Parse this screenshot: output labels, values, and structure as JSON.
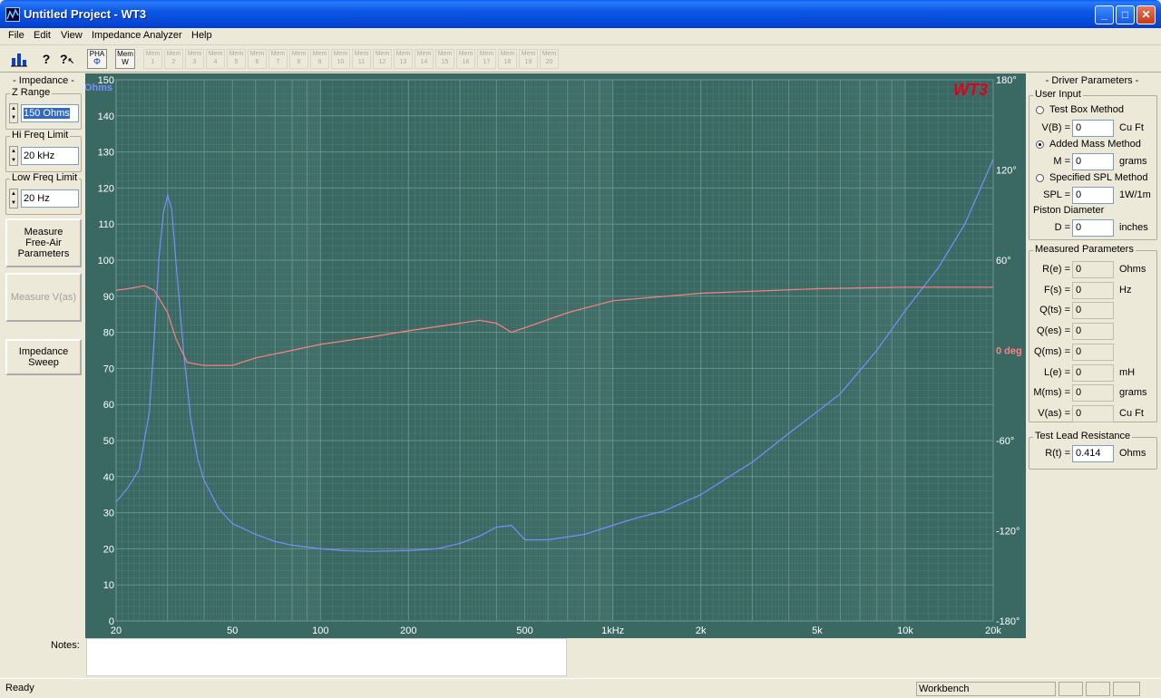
{
  "window": {
    "title": "Untitled Project - WT3",
    "minimize": "_",
    "maximize": "□",
    "close": "✕"
  },
  "menu": [
    "File",
    "Edit",
    "View",
    "Impedance Analyzer",
    "Help"
  ],
  "toolbar": {
    "pha_top": "PHA",
    "pha_bottom": "Φ",
    "mem_top": "Mem",
    "mem_bottom": "W",
    "mem_labels": [
      "1",
      "2",
      "3",
      "4",
      "5",
      "6",
      "7",
      "8",
      "9",
      "10",
      "11",
      "12",
      "13",
      "14",
      "15",
      "16",
      "17",
      "18",
      "19",
      "20"
    ]
  },
  "left": {
    "header": "- Impedance -",
    "z_range": {
      "label": "Z Range",
      "value": "150 Ohms"
    },
    "hi_freq": {
      "label": "Hi Freq Limit",
      "value": "20 kHz"
    },
    "low_freq": {
      "label": "Low Freq Limit",
      "value": "20 Hz"
    },
    "measure_free_air": "Measure Free-Air Parameters",
    "measure_vas": "Measure V(as)",
    "impedance_sweep": "Impedance Sweep"
  },
  "graph": {
    "logo": "WT3",
    "y_unit": "Ohms",
    "y_ticks": [
      "150",
      "140",
      "130",
      "120",
      "110",
      "100",
      "90",
      "80",
      "70",
      "60",
      "50",
      "40",
      "30",
      "20",
      "10",
      "0"
    ],
    "phase_ticks": [
      "180°",
      "120°",
      "60°",
      "0 deg",
      "-60°",
      "-120°",
      "-180°"
    ],
    "x_ticks": [
      {
        "f": 20,
        "label": "20"
      },
      {
        "f": 50,
        "label": "50"
      },
      {
        "f": 100,
        "label": "100"
      },
      {
        "f": 200,
        "label": "200"
      },
      {
        "f": 500,
        "label": "500"
      },
      {
        "f": 1000,
        "label": "1kHz"
      },
      {
        "f": 2000,
        "label": "2k"
      },
      {
        "f": 5000,
        "label": "5k"
      },
      {
        "f": 10000,
        "label": "10k"
      },
      {
        "f": 20000,
        "label": "20k"
      }
    ],
    "colors": {
      "background": "#3a6963",
      "impedance": "#7c8cff",
      "phase": "#ff8080",
      "grid": "#6f9590",
      "axis_text": "#ffffff",
      "logo": "#e0001c"
    }
  },
  "chart_data": {
    "type": "line",
    "xlabel": "",
    "ylabel": "Ohms",
    "xscale": "log",
    "xlim": [
      20,
      20000
    ],
    "ylim": [
      0,
      150
    ],
    "y2lim": [
      -180,
      180
    ],
    "grid": true,
    "series": [
      {
        "axis": "left",
        "values": [
          [
            20,
            33
          ],
          [
            22,
            37
          ],
          [
            24,
            42
          ],
          [
            26,
            58
          ],
          [
            27,
            78
          ],
          [
            28,
            100
          ],
          [
            29,
            113
          ],
          [
            30,
            118
          ],
          [
            31,
            114
          ],
          [
            32,
            100
          ],
          [
            34,
            75
          ],
          [
            36,
            56
          ],
          [
            38,
            45
          ],
          [
            40,
            39
          ],
          [
            45,
            31
          ],
          [
            50,
            27
          ],
          [
            60,
            24
          ],
          [
            70,
            22
          ],
          [
            80,
            21
          ],
          [
            100,
            20
          ],
          [
            120,
            19.5
          ],
          [
            150,
            19.3
          ],
          [
            200,
            19.5
          ],
          [
            250,
            20
          ],
          [
            300,
            21.5
          ],
          [
            350,
            23.5
          ],
          [
            400,
            26
          ],
          [
            450,
            26.5
          ],
          [
            500,
            22.5
          ],
          [
            600,
            22.5
          ],
          [
            800,
            24
          ],
          [
            1000,
            26.5
          ],
          [
            1200,
            28.5
          ],
          [
            1500,
            30.5
          ],
          [
            2000,
            35
          ],
          [
            2500,
            40
          ],
          [
            3000,
            44
          ],
          [
            4000,
            52
          ],
          [
            5000,
            58
          ],
          [
            6000,
            63
          ],
          [
            8000,
            75
          ],
          [
            10000,
            86
          ],
          [
            13000,
            98
          ],
          [
            16000,
            110
          ],
          [
            20000,
            128
          ]
        ]
      },
      {
        "axis": "right",
        "values": [
          [
            20,
            40
          ],
          [
            22,
            41
          ],
          [
            25,
            43
          ],
          [
            27,
            40
          ],
          [
            30,
            25
          ],
          [
            32,
            8
          ],
          [
            35,
            -8
          ],
          [
            40,
            -10
          ],
          [
            50,
            -10
          ],
          [
            60,
            -5
          ],
          [
            80,
            0
          ],
          [
            100,
            4
          ],
          [
            150,
            9
          ],
          [
            200,
            13
          ],
          [
            300,
            18
          ],
          [
            350,
            20
          ],
          [
            400,
            18
          ],
          [
            450,
            12
          ],
          [
            500,
            15
          ],
          [
            700,
            25
          ],
          [
            1000,
            33
          ],
          [
            2000,
            38
          ],
          [
            5000,
            41
          ],
          [
            10000,
            42
          ],
          [
            20000,
            42
          ]
        ]
      }
    ]
  },
  "right": {
    "header": "- Driver Parameters -",
    "user_input": {
      "title": "User Input",
      "test_box": "Test Box Method",
      "vb_label": "V(B) =",
      "vb_value": "0",
      "vb_unit": "Cu Ft",
      "added_mass": "Added Mass Method",
      "m_label": "M =",
      "m_value": "0",
      "m_unit": "grams",
      "spl": "Specified SPL Method",
      "spl_label": "SPL =",
      "spl_value": "0",
      "spl_unit": "1W/1m",
      "piston": "Piston Diameter",
      "d_label": "D =",
      "d_value": "0",
      "d_unit": "inches"
    },
    "measured": {
      "title": "Measured Parameters",
      "rows": [
        {
          "label": "R(e) =",
          "value": "0",
          "unit": "Ohms"
        },
        {
          "label": "F(s) =",
          "value": "0",
          "unit": "Hz"
        },
        {
          "label": "Q(ts) =",
          "value": "0",
          "unit": ""
        },
        {
          "label": "Q(es) =",
          "value": "0",
          "unit": ""
        },
        {
          "label": "Q(ms) =",
          "value": "0",
          "unit": ""
        },
        {
          "label": "L(e) =",
          "value": "0",
          "unit": "mH"
        },
        {
          "label": "M(ms) =",
          "value": "0",
          "unit": "grams"
        },
        {
          "label": "V(as) =",
          "value": "0",
          "unit": "Cu Ft"
        }
      ]
    },
    "lead": {
      "title": "Test Lead Resistance",
      "label": "R(t) =",
      "value": "0.414",
      "unit": "Ohms"
    }
  },
  "notes": {
    "label": "Notes:"
  },
  "status": {
    "left": "Ready",
    "mode": "Workbench"
  }
}
